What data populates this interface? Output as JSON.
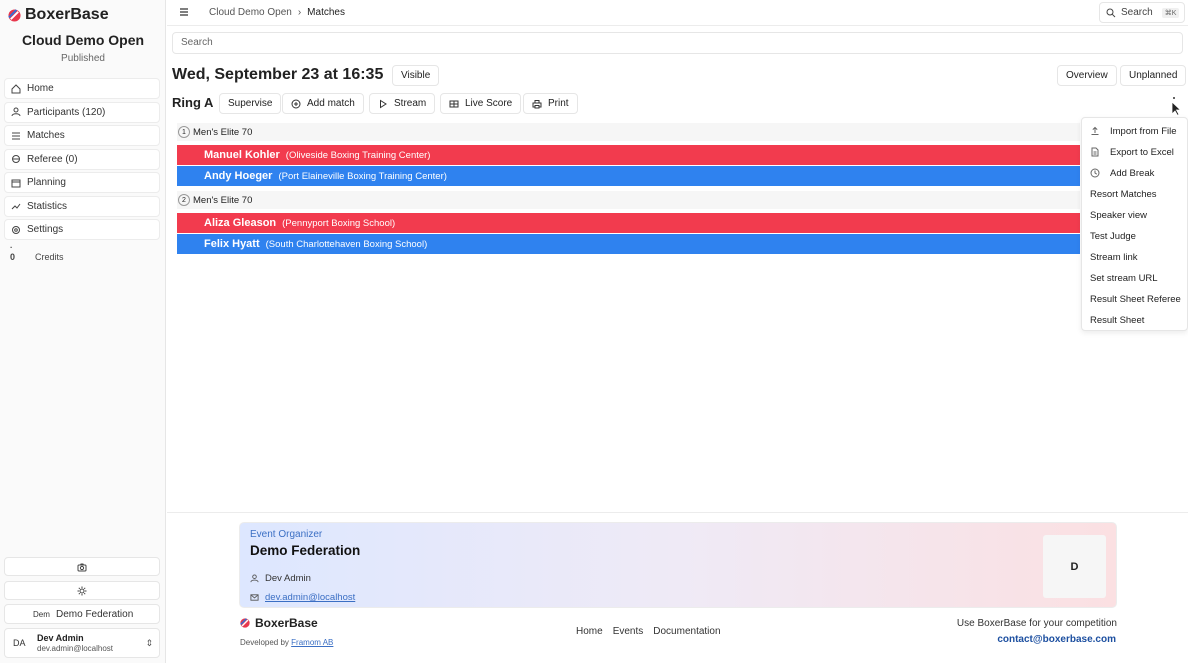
{
  "sidebar": {
    "brand": "BoxerBase",
    "event_title": "Cloud Demo Open",
    "event_status": "Published",
    "items": [
      {
        "label": "Home",
        "icon": "home-icon"
      },
      {
        "label": "Participants (120)",
        "icon": "user-icon"
      },
      {
        "label": "Matches",
        "icon": "list-icon"
      },
      {
        "label": "Referee (0)",
        "icon": "referee-icon"
      },
      {
        "label": "Planning",
        "icon": "calendar-icon"
      },
      {
        "label": "Statistics",
        "icon": "chart-icon"
      },
      {
        "label": "Settings",
        "icon": "gear-icon"
      }
    ],
    "credits_count": "0",
    "credits_label": "Credits",
    "org_abbr": "Dem",
    "org_name": "Demo Federation",
    "user": {
      "initials": "DA",
      "name": "Dev Admin",
      "email": "dev.admin@localhost"
    }
  },
  "topbar": {
    "breadcrumb": [
      "Cloud Demo Open",
      "Matches"
    ],
    "search_label": "Search",
    "search_kbd": "⌘K"
  },
  "main": {
    "search_placeholder": "Search",
    "date_title": "Wed, September 23 at 16:35",
    "visible_label": "Visible",
    "overview_label": "Overview",
    "unplanned_label": "Unplanned",
    "ring_title": "Ring A",
    "ring_buttons": {
      "supervise": "Supervise",
      "add_match": "Add match",
      "stream": "Stream",
      "live_score": "Live Score",
      "print": "Print"
    },
    "matches": [
      {
        "index": "1",
        "category": "Men's Elite 70",
        "red": {
          "name": "Manuel Kohler",
          "club": "(Oliveside Boxing Training Center)"
        },
        "blue": {
          "name": "Andy Hoeger",
          "club": "(Port Elaineville Boxing Training Center)"
        }
      },
      {
        "index": "2",
        "category": "Men's Elite 70",
        "red": {
          "name": "Aliza Gleason",
          "club": "(Pennyport Boxing School)"
        },
        "blue": {
          "name": "Felix Hyatt",
          "club": "(South Charlottehaven Boxing School)"
        }
      }
    ]
  },
  "dropdown": {
    "items": [
      {
        "label": "Import from File",
        "icon": "upload-icon"
      },
      {
        "label": "Export to Excel",
        "icon": "file-icon"
      },
      {
        "label": "Add Break",
        "icon": "clock-icon"
      },
      {
        "label": "Resort Matches"
      },
      {
        "label": "Speaker view"
      },
      {
        "label": "Test Judge"
      },
      {
        "label": "Stream link"
      },
      {
        "label": "Set stream URL"
      },
      {
        "label": "Result Sheet Referee"
      },
      {
        "label": "Result Sheet"
      }
    ]
  },
  "footer": {
    "organizer_label": "Event Organizer",
    "organizer_name": "Demo Federation",
    "contact_name": "Dev Admin",
    "contact_email": "dev.admin@localhost",
    "logo_letter": "D",
    "brand": "BoxerBase",
    "developed_by_prefix": "Developed by",
    "developed_by_link": "Framom AB",
    "links": [
      "Home",
      "Events",
      "Documentation"
    ],
    "cta": "Use BoxerBase for your competition",
    "cta_email": "contact@boxerbase.com"
  },
  "colors": {
    "red_corner": "#f23b4e",
    "blue_corner": "#2f82ef",
    "link": "#3b6fc4"
  }
}
